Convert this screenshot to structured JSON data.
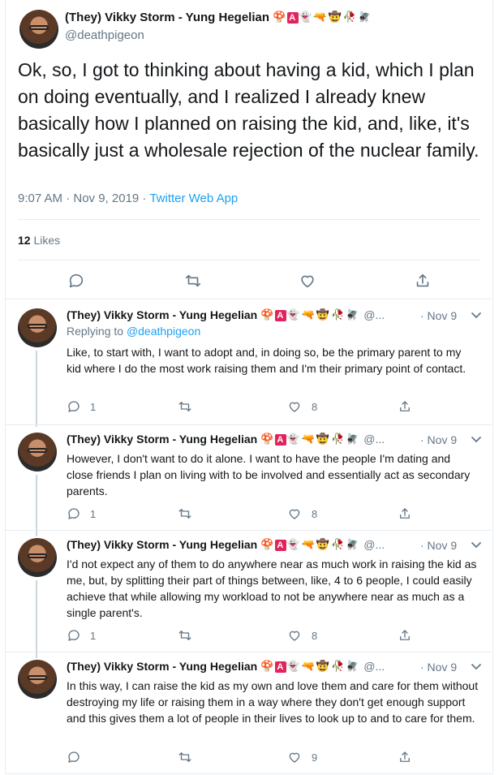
{
  "main_tweet": {
    "display_name": "(They) Vikky Storm - Yung Hegelian",
    "handle": "@deathpigeon",
    "text": "Ok, so, I got to thinking about having a kid, which I plan on doing eventually, and I realized I already knew basically how I planned on raising the kid, and, like, it's basically just a wholesale rejection of the nuclear family.",
    "time": "9:07 AM · Nov 9, 2019",
    "source": "Twitter Web App",
    "likes_count": "12",
    "likes_label": "Likes"
  },
  "name_emojis": [
    "🍄",
    "A",
    "👻",
    "🔫",
    "🤠",
    "🥀",
    "🪰"
  ],
  "replies": [
    {
      "display_name": "(They) Vikky Storm - Yung Hegelian",
      "handle": "@...",
      "date": "· Nov 9",
      "replying_to_label": "Replying to",
      "replying_to_handle": "@deathpigeon",
      "text": "Like, to start with, I want to adopt and, in doing so, be the primary parent to my kid where I do the most work raising them and I'm their primary point of contact.",
      "reply_count": "1",
      "like_count": "8"
    },
    {
      "display_name": "(They) Vikky Storm - Yung Hegelian",
      "handle": "@...",
      "date": "· Nov 9",
      "text": "However, I don't want to do it alone. I want to have the people I'm dating and close friends I plan on living with to be involved and essentially act as secondary parents.",
      "reply_count": "1",
      "like_count": "8"
    },
    {
      "display_name": "(They) Vikky Storm - Yung Hegelian",
      "handle": "@...",
      "date": "· Nov 9",
      "text": "I'd not expect any of them to do anywhere near as much work in raising the kid as me, but, by splitting their part of things between, like, 4 to 6 people, I could easily achieve that while allowing my workload to not be anywhere near as much as a single parent's.",
      "reply_count": "1",
      "like_count": "8"
    },
    {
      "display_name": "(They) Vikky Storm - Yung Hegelian",
      "handle": "@...",
      "date": "· Nov 9",
      "text": "In this way, I can raise the kid as my own and love them and care for them without destroying my life or raising them in a way where they don't get enough support and this gives them a lot of people in their lives to look up to and to care for them.",
      "reply_count": "",
      "like_count": "9"
    }
  ],
  "icons": {
    "reply": "reply-icon",
    "retweet": "retweet-icon",
    "like": "heart-icon",
    "share": "share-icon",
    "more": "chevron-down-icon"
  },
  "colors": {
    "link": "#1da1f2",
    "muted": "#657786",
    "text": "#14171a",
    "divider": "#e6ecf0"
  }
}
